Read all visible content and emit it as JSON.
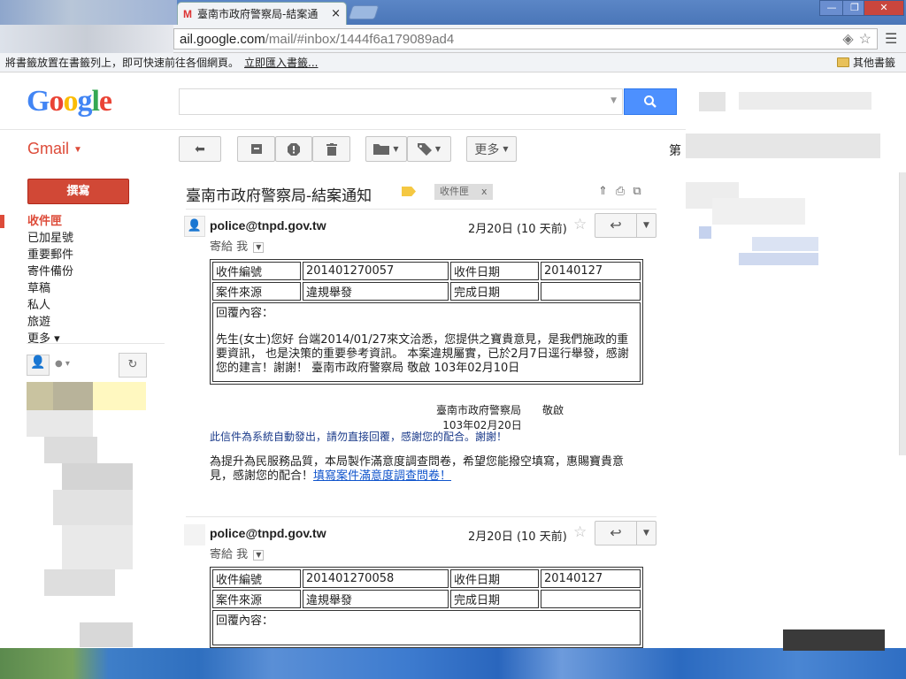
{
  "browser": {
    "tab_title": "臺南市政府警察局-結案通",
    "tab_close": "×",
    "url_main": "ail.google.com",
    "url_rest": "/mail/#inbox/1444f6a179089ad4",
    "bookmark_hint": "將書籤放置在書籤列上，即可快速前往各個網頁。",
    "bookmark_import": "立即匯入書籤...",
    "other_bookmarks": "其他書籤",
    "win_min": "—",
    "win_max": "❐",
    "win_close": "✕"
  },
  "header": {
    "logo": "Google",
    "gmail_label": "Gmail",
    "more_label": "更多",
    "page_info": "第"
  },
  "toolbar": {
    "back_icon": "↩",
    "archive_icon": "▣",
    "spam_icon": "!",
    "delete_icon": "🗑"
  },
  "sidebar": {
    "compose": "撰寫",
    "items": [
      {
        "label": "收件匣",
        "active": true
      },
      {
        "label": "已加星號"
      },
      {
        "label": "重要郵件"
      },
      {
        "label": "寄件備份"
      },
      {
        "label": "草稿"
      },
      {
        "label": "私人"
      },
      {
        "label": "旅遊"
      },
      {
        "label": "更多 ▾"
      }
    ]
  },
  "thread": {
    "subject": "臺南市政府警察局-結案通知",
    "label": "收件匣",
    "label_close": "x"
  },
  "messages": [
    {
      "sender": "police@tnpd.gov.tw",
      "date": "2月20日 (10 天前)",
      "to": "寄給 我",
      "case_no_label": "收件編號",
      "case_no": "201401270057",
      "recv_date_label": "收件日期",
      "recv_date": "20140127",
      "source_label": "案件來源",
      "source": "違規舉發",
      "done_label": "完成日期",
      "done": "",
      "reply_label": "回覆內容：",
      "reply_body": "先生(女士)您好 台端2014/01/27來文洽悉，您提供之寶貴意見，是我們施政的重要資訊， 也是決策的重要參考資訊。 本案違規屬實，已於2月7日逕行舉發，感謝您的建言！謝謝！ 臺南市政府警察局 敬啟 103年02月10日",
      "sign_org": "臺南市政府警察局　　敬啟",
      "sign_date": "103年02月20日",
      "notice": "此信件為系統自動發出，請勿直接回覆，感謝您的配合。謝謝！",
      "survey": "為提升為民服務品質，本局製作滿意度調查問卷，希望您能撥空填寫，惠賜寶貴意見，感謝您的配合！",
      "survey_link": "填寫案件滿意度調查問卷！"
    },
    {
      "sender": "police@tnpd.gov.tw",
      "date": "2月20日 (10 天前)",
      "to": "寄給 我",
      "case_no_label": "收件編號",
      "case_no": "201401270058",
      "recv_date_label": "收件日期",
      "recv_date": "20140127",
      "source_label": "案件來源",
      "source": "違規舉發",
      "done_label": "完成日期",
      "done": "",
      "reply_label": "回覆內容："
    }
  ],
  "colors": {
    "gmail_red": "#dd4b39",
    "compose_red": "#d14836",
    "search_blue": "#4d90fe",
    "link_blue": "#1155cc"
  }
}
